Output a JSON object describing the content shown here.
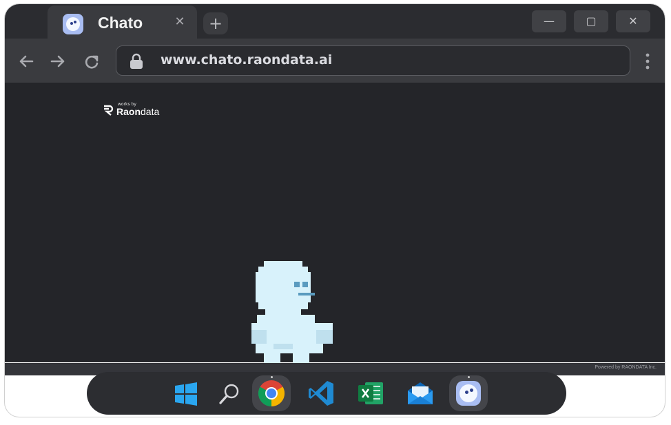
{
  "browser": {
    "tab": {
      "title": "Chato",
      "close_glyph": "✕"
    },
    "new_tab_glyph": "+",
    "window_controls": {
      "minimize": "—",
      "maximize": "▢",
      "close": "✕"
    },
    "toolbar": {
      "url": "www.chato.raondata.ai"
    }
  },
  "page": {
    "brand": {
      "prefix": "works by",
      "name_bold": "Raon",
      "name_light": "data"
    },
    "footer": "Powered by RAONDATA Inc."
  },
  "taskbar": {
    "items": [
      "windows-start",
      "search",
      "chrome",
      "vscode",
      "excel",
      "mail",
      "chato"
    ],
    "active": [
      "chrome",
      "chato"
    ]
  },
  "colors": {
    "background": "#242529",
    "titlebar": "#2b2c30",
    "mascot": "#d8f2fb"
  }
}
